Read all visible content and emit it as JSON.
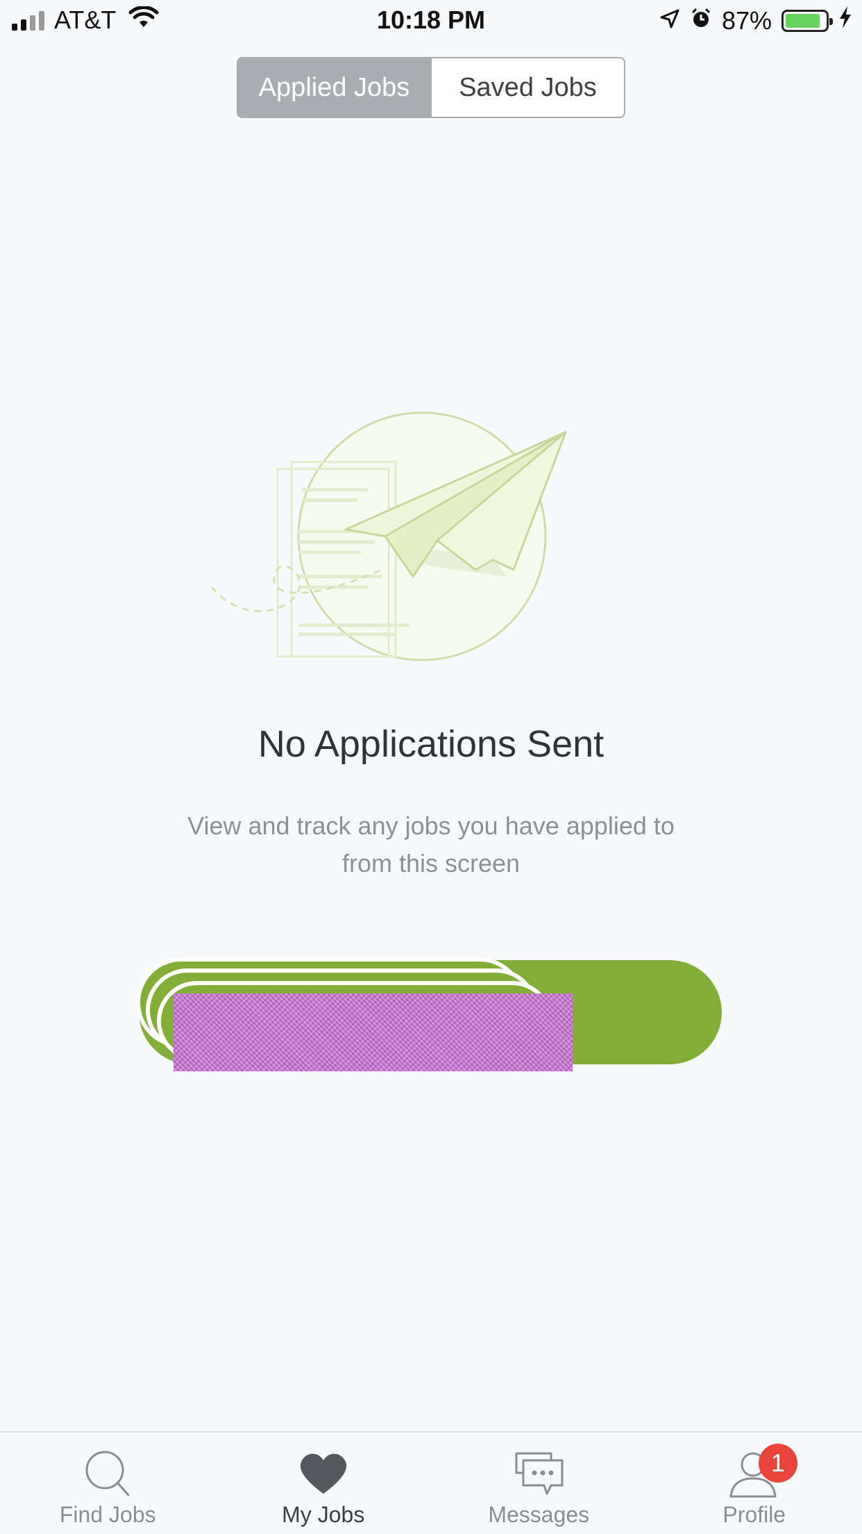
{
  "status_bar": {
    "carrier": "AT&T",
    "time": "10:18 PM",
    "battery_percent": "87%",
    "battery_level": 0.87
  },
  "segmented": {
    "tabs": [
      {
        "label": "Applied Jobs",
        "active": true
      },
      {
        "label": "Saved Jobs",
        "active": false
      }
    ]
  },
  "empty_state": {
    "illustration": "paper-plane-icon",
    "title": "No Applications Sent",
    "description": "View and track any jobs you have applied to from this screen"
  },
  "cta": {
    "color": "#82ae37"
  },
  "tab_bar": {
    "tabs": [
      {
        "label": "Find Jobs",
        "icon": "search-icon",
        "active": false
      },
      {
        "label": "My Jobs",
        "icon": "heart-icon",
        "active": true
      },
      {
        "label": "Messages",
        "icon": "chat-icon",
        "active": false
      },
      {
        "label": "Profile",
        "icon": "person-icon",
        "active": false,
        "badge": "1"
      }
    ]
  },
  "colors": {
    "accent_green": "#82ae37",
    "badge_red": "#e8443a",
    "segment_active": "#a9acb0"
  }
}
